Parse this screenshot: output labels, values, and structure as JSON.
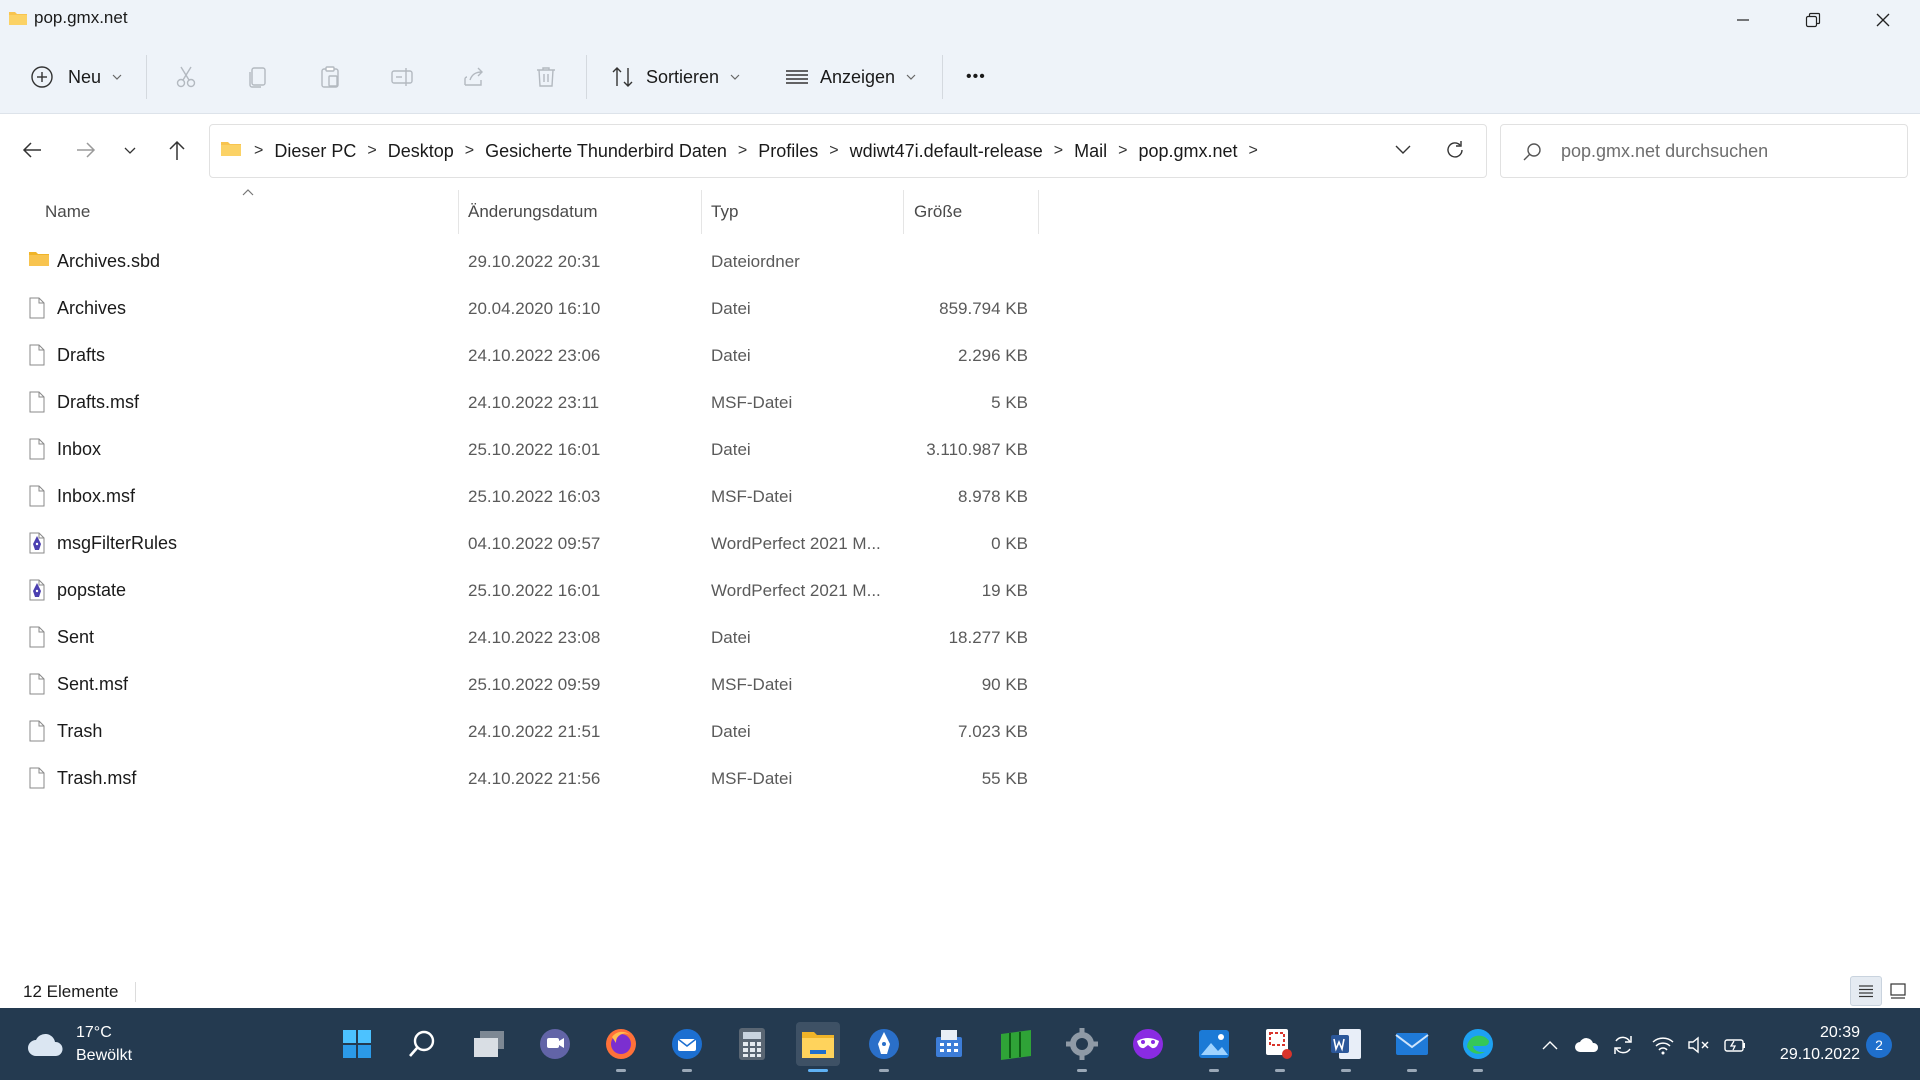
{
  "window": {
    "title": "pop.gmx.net",
    "controls": [
      "minimize",
      "restore",
      "close"
    ]
  },
  "commandbar": {
    "new_label": "Neu",
    "sort_label": "Sortieren",
    "view_label": "Anzeigen",
    "more_label": "•••",
    "icons": [
      "cut-icon",
      "copy-icon",
      "paste-icon",
      "rename-icon",
      "share-icon",
      "delete-icon"
    ]
  },
  "address": {
    "crumbs": [
      "Dieser PC",
      "Desktop",
      "Gesicherte Thunderbird Daten",
      "Profiles",
      "wdiwt47i.default-release",
      "Mail",
      "pop.gmx.net"
    ],
    "separator": ">"
  },
  "search": {
    "placeholder": "pop.gmx.net durchsuchen"
  },
  "columns": {
    "name": "Name",
    "date": "Änderungsdatum",
    "type": "Typ",
    "size": "Größe"
  },
  "files": [
    {
      "name": "Archives.sbd",
      "date": "29.10.2022 20:31",
      "type": "Dateiordner",
      "size": "",
      "icon": "folder-icon"
    },
    {
      "name": "Archives",
      "date": "20.04.2020 16:10",
      "type": "Datei",
      "size": "859.794 KB",
      "icon": "file-icon"
    },
    {
      "name": "Drafts",
      "date": "24.10.2022 23:06",
      "type": "Datei",
      "size": "2.296 KB",
      "icon": "file-icon"
    },
    {
      "name": "Drafts.msf",
      "date": "24.10.2022 23:11",
      "type": "MSF-Datei",
      "size": "5 KB",
      "icon": "file-icon"
    },
    {
      "name": "Inbox",
      "date": "25.10.2022 16:01",
      "type": "Datei",
      "size": "3.110.987 KB",
      "icon": "file-icon"
    },
    {
      "name": "Inbox.msf",
      "date": "25.10.2022 16:03",
      "type": "MSF-Datei",
      "size": "8.978 KB",
      "icon": "file-icon"
    },
    {
      "name": "msgFilterRules",
      "date": "04.10.2022 09:57",
      "type": "WordPerfect 2021 M...",
      "size": "0 KB",
      "icon": "wordperfect-icon"
    },
    {
      "name": "popstate",
      "date": "25.10.2022 16:01",
      "type": "WordPerfect 2021 M...",
      "size": "19 KB",
      "icon": "wordperfect-icon"
    },
    {
      "name": "Sent",
      "date": "24.10.2022 23:08",
      "type": "Datei",
      "size": "18.277 KB",
      "icon": "file-icon"
    },
    {
      "name": "Sent.msf",
      "date": "25.10.2022 09:59",
      "type": "MSF-Datei",
      "size": "90 KB",
      "icon": "file-icon"
    },
    {
      "name": "Trash",
      "date": "24.10.2022 21:51",
      "type": "Datei",
      "size": "7.023 KB",
      "icon": "file-icon"
    },
    {
      "name": "Trash.msf",
      "date": "24.10.2022 21:56",
      "type": "MSF-Datei",
      "size": "55 KB",
      "icon": "file-icon"
    }
  ],
  "status": {
    "count": "12 Elemente"
  },
  "taskbar": {
    "weather_temp": "17°C",
    "weather_cond": "Bewölkt",
    "apps": [
      "start-icon",
      "search-icon",
      "task-view-icon",
      "teams-chat-icon",
      "firefox-icon",
      "thunderbird-icon",
      "calculator-icon",
      "file-explorer-icon",
      "wordperfect-app-icon",
      "fax-icon",
      "spreadsheet-app-icon",
      "settings-icon",
      "mask-app-icon",
      "photos-icon",
      "snipping-tool-icon",
      "word-icon",
      "mail-icon",
      "edge-icon"
    ],
    "tray": [
      "chevron-up-icon",
      "onedrive-icon",
      "sync-icon",
      "wifi-icon",
      "volume-muted-icon",
      "battery-icon"
    ],
    "time": "20:39",
    "date": "29.10.2022",
    "notifications": "2"
  },
  "colors": {
    "chrome": "#eef3f9",
    "taskbar": "#243a50",
    "accent": "#1f6fcc",
    "folder": "#f8c44f"
  }
}
